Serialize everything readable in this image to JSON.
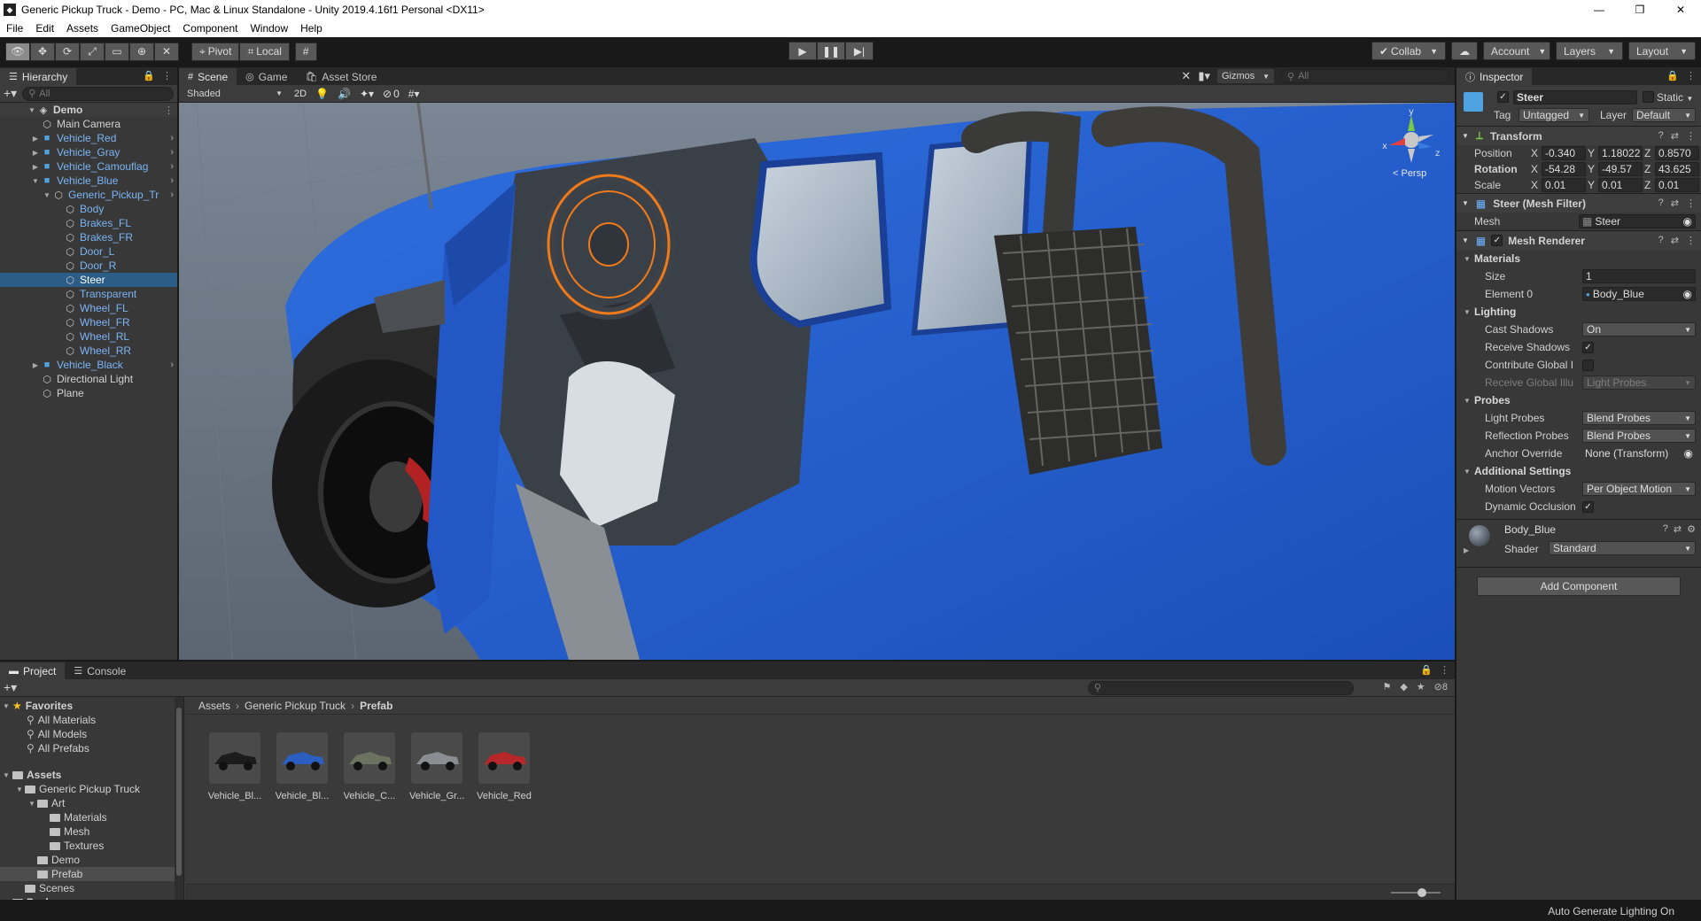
{
  "window": {
    "title": "Generic Pickup Truck - Demo - PC, Mac & Linux Standalone - Unity 2019.4.16f1 Personal <DX11>",
    "minimize": "—",
    "restore": "❐",
    "close": "✕"
  },
  "menu": [
    "File",
    "Edit",
    "Assets",
    "GameObject",
    "Component",
    "Window",
    "Help"
  ],
  "toolbar": {
    "pivot": "Pivot",
    "local": "Local",
    "collab": "Collab",
    "account": "Account",
    "layers": "Layers",
    "layout": "Layout"
  },
  "hierarchy": {
    "tab": "Hierarchy",
    "search_placeholder": "All",
    "scene": "Demo",
    "items": [
      {
        "label": "Main Camera",
        "depth": 1,
        "prefab": false,
        "arrow": ""
      },
      {
        "label": "Vehicle_Red",
        "depth": 1,
        "prefab": true,
        "arrow": "▶"
      },
      {
        "label": "Vehicle_Gray",
        "depth": 1,
        "prefab": true,
        "arrow": "▶"
      },
      {
        "label": "Vehicle_Camouflag",
        "depth": 1,
        "prefab": true,
        "arrow": "▶"
      },
      {
        "label": "Vehicle_Blue",
        "depth": 1,
        "prefab": true,
        "arrow": "▼"
      },
      {
        "label": "Generic_Pickup_Tr",
        "depth": 2,
        "prefab": true,
        "arrow": "▼"
      },
      {
        "label": "Body",
        "depth": 3,
        "prefab": true,
        "arrow": ""
      },
      {
        "label": "Brakes_FL",
        "depth": 3,
        "prefab": true,
        "arrow": ""
      },
      {
        "label": "Brakes_FR",
        "depth": 3,
        "prefab": true,
        "arrow": ""
      },
      {
        "label": "Door_L",
        "depth": 3,
        "prefab": true,
        "arrow": ""
      },
      {
        "label": "Door_R",
        "depth": 3,
        "prefab": true,
        "arrow": ""
      },
      {
        "label": "Steer",
        "depth": 3,
        "prefab": false,
        "arrow": "",
        "selected": true
      },
      {
        "label": "Transparent",
        "depth": 3,
        "prefab": true,
        "arrow": ""
      },
      {
        "label": "Wheel_FL",
        "depth": 3,
        "prefab": true,
        "arrow": ""
      },
      {
        "label": "Wheel_FR",
        "depth": 3,
        "prefab": true,
        "arrow": ""
      },
      {
        "label": "Wheel_RL",
        "depth": 3,
        "prefab": true,
        "arrow": ""
      },
      {
        "label": "Wheel_RR",
        "depth": 3,
        "prefab": true,
        "arrow": ""
      },
      {
        "label": "Vehicle_Black",
        "depth": 1,
        "prefab": true,
        "arrow": "▶"
      },
      {
        "label": "Directional Light",
        "depth": 1,
        "prefab": false,
        "arrow": ""
      },
      {
        "label": "Plane",
        "depth": 1,
        "prefab": false,
        "arrow": ""
      }
    ]
  },
  "scene": {
    "tabs": [
      "Scene",
      "Game",
      "Asset Store"
    ],
    "shading": "Shaded",
    "mode_2d": "2D",
    "hidden_count": "0",
    "gizmos": "Gizmos",
    "search_placeholder": "All",
    "persp": "< Persp",
    "gizmo_axes": {
      "x": "x",
      "y": "y",
      "z": "z"
    }
  },
  "inspector": {
    "tab": "Inspector",
    "object_name": "Steer",
    "static": "Static",
    "tag_label": "Tag",
    "tag": "Untagged",
    "layer_label": "Layer",
    "layer": "Default",
    "transform": {
      "title": "Transform",
      "position_label": "Position",
      "rotation_label": "Rotation",
      "scale_label": "Scale",
      "position": {
        "x": "-0.340",
        "y": "1.18022",
        "z": "0.8570"
      },
      "rotation": {
        "x": "-54.28",
        "y": "-49.57",
        "z": "43.625"
      },
      "scale": {
        "x": "0.01",
        "y": "0.01",
        "z": "0.01"
      }
    },
    "mesh_filter": {
      "title": "Steer (Mesh Filter)",
      "mesh_label": "Mesh",
      "mesh": "Steer"
    },
    "mesh_renderer": {
      "title": "Mesh Renderer",
      "materials": "Materials",
      "size_label": "Size",
      "size": "1",
      "element0_label": "Element 0",
      "element0": "Body_Blue",
      "lighting": "Lighting",
      "cast_shadows_label": "Cast Shadows",
      "cast_shadows": "On",
      "receive_shadows_label": "Receive Shadows",
      "contribute_gi_label": "Contribute Global I",
      "receive_gi_label": "Receive Global Illu",
      "receive_gi": "Light Probes",
      "probes": "Probes",
      "light_probes_label": "Light Probes",
      "light_probes": "Blend Probes",
      "reflection_probes_label": "Reflection Probes",
      "reflection_probes": "Blend Probes",
      "anchor_override_label": "Anchor Override",
      "anchor_override": "None (Transform)",
      "additional": "Additional Settings",
      "motion_vectors_label": "Motion Vectors",
      "motion_vectors": "Per Object Motion",
      "dynamic_occlusion_label": "Dynamic Occlusion"
    },
    "material": {
      "name": "Body_Blue",
      "shader_label": "Shader",
      "shader": "Standard"
    },
    "add_component": "Add Component"
  },
  "project": {
    "tabs": [
      "Project",
      "Console"
    ],
    "hidden_count": "8",
    "favorites": "Favorites",
    "fav_items": [
      "All Materials",
      "All Models",
      "All Prefabs"
    ],
    "assets": "Assets",
    "tree": [
      {
        "label": "Generic Pickup Truck",
        "depth": 1,
        "arrow": "▼"
      },
      {
        "label": "Art",
        "depth": 2,
        "arrow": "▼"
      },
      {
        "label": "Materials",
        "depth": 3,
        "arrow": ""
      },
      {
        "label": "Mesh",
        "depth": 3,
        "arrow": ""
      },
      {
        "label": "Textures",
        "depth": 3,
        "arrow": ""
      },
      {
        "label": "Demo",
        "depth": 2,
        "arrow": ""
      },
      {
        "label": "Prefab",
        "depth": 2,
        "arrow": "",
        "selected": true
      },
      {
        "label": "Scenes",
        "depth": 1,
        "arrow": ""
      },
      {
        "label": "Packages",
        "depth": 0,
        "arrow": "▶"
      }
    ],
    "breadcrumb": [
      "Assets",
      "Generic Pickup Truck",
      "Prefab"
    ],
    "assets_grid": [
      {
        "label": "Vehicle_Bl...",
        "color": "#1c1c1c"
      },
      {
        "label": "Vehicle_Bl...",
        "color": "#2a5fc0"
      },
      {
        "label": "Vehicle_C...",
        "color": "#6b7360"
      },
      {
        "label": "Vehicle_Gr...",
        "color": "#8a8d92"
      },
      {
        "label": "Vehicle_Red",
        "color": "#b8282b"
      }
    ]
  },
  "status": {
    "text": "Auto Generate Lighting On"
  }
}
